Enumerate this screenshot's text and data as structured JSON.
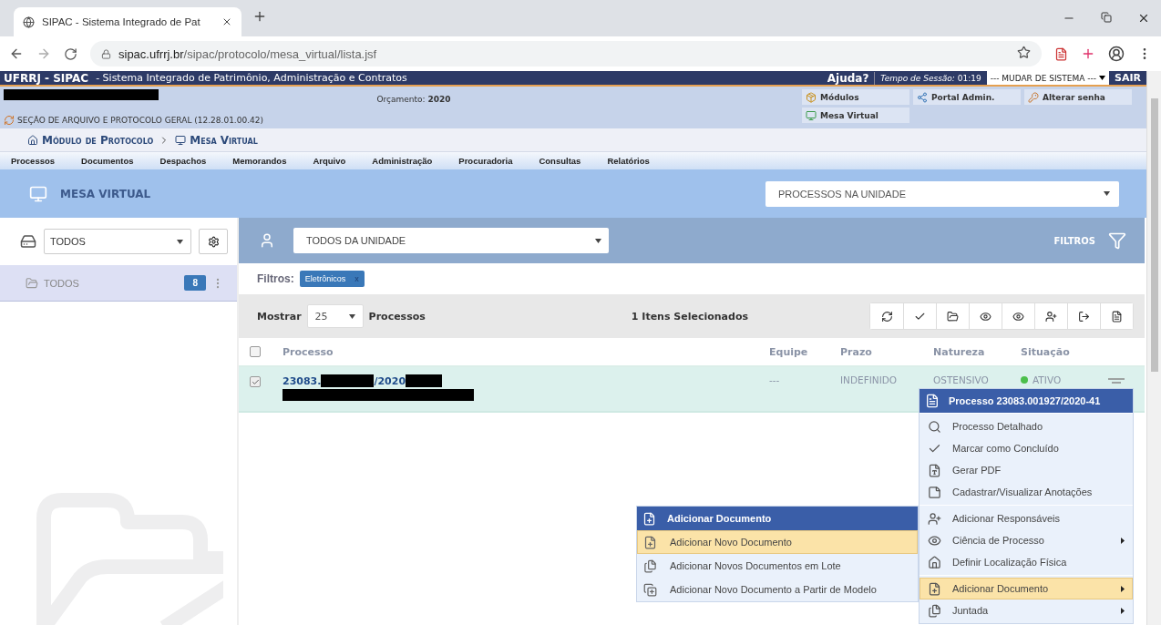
{
  "browser": {
    "tab_title": "SIPAC - Sistema Integrado de Pat",
    "url_host": "sipac.ufrrj.br",
    "url_path": "/sipac/protocolo/mesa_virtual/lista.jsf"
  },
  "top_bar": {
    "brand": "UFRRJ - SIPAC",
    "subtitle": "- Sistema Integrado de Patrimônio, Administração e Contratos",
    "help": "Ajuda?",
    "session_label": "Tempo de Sessão:",
    "session_time": "01:19",
    "system_select": "--- MUDAR DE SISTEMA ---",
    "logout": "SAIR"
  },
  "info": {
    "user_redacted": true,
    "unit": "SEÇÃO DE ARQUIVO E PROTOCOLO GERAL (12.28.01.00.42)",
    "budget_label": "Orçamento:",
    "budget_year": "2020",
    "links": [
      "Módulos",
      "Portal Admin.",
      "Alterar senha",
      "Mesa Virtual"
    ]
  },
  "breadcrumb": [
    "Módulo de Protocolo",
    "Mesa Virtual"
  ],
  "menu": [
    "Processos",
    "Documentos",
    "Despachos",
    "Memorandos",
    "Arquivo",
    "Administração",
    "Procuradoria",
    "Consultas",
    "Relatórios"
  ],
  "page_header": {
    "title": "MESA VIRTUAL",
    "view_select": "PROCESSOS NA UNIDADE"
  },
  "sidebar": {
    "select": "TODOS",
    "folders": [
      {
        "label": "TODOS",
        "count": "8",
        "selected": true
      }
    ]
  },
  "panel": {
    "owner_select": "TODOS DA UNIDADE",
    "filters_button": "FILTROS",
    "filters_label": "Filtros:",
    "filter_tags": [
      {
        "label": "Eletrônicos",
        "remove": "x"
      }
    ],
    "show_label": "Mostrar",
    "page_size": "25",
    "show_suffix": "Processos",
    "selection_count": "1 Itens Selecionados"
  },
  "table": {
    "columns": [
      "Processo",
      "Equipe",
      "Prazo",
      "Natureza",
      "Situação"
    ],
    "header_checked": false,
    "rows": [
      {
        "checked": true,
        "selected": true,
        "number_parts": [
          "23083.",
          "/2020"
        ],
        "redacted": true,
        "team": "---",
        "deadline": "INDEFINIDO",
        "nature": "OSTENSIVO",
        "status": "ATIVO",
        "color": "#4cbf4c"
      }
    ]
  },
  "context_menu": {
    "title": "Processo 23083.001927/2020-41",
    "groups": [
      [
        {
          "label": "Processo Detalhado",
          "has_submenu": false,
          "highlighted": false
        },
        {
          "label": "Marcar como Concluído",
          "has_submenu": false,
          "highlighted": false
        },
        {
          "label": "Gerar PDF",
          "has_submenu": false,
          "highlighted": false
        },
        {
          "label": "Cadastrar/Visualizar Anotações",
          "has_submenu": false,
          "highlighted": false
        }
      ],
      [
        {
          "label": "Adicionar Responsáveis",
          "has_submenu": false,
          "highlighted": false
        },
        {
          "label": "Ciência de Processo",
          "has_submenu": true,
          "highlighted": false
        },
        {
          "label": "Definir Localização Física",
          "has_submenu": false,
          "highlighted": false
        }
      ],
      [
        {
          "label": "Adicionar Documento",
          "has_submenu": true,
          "highlighted": true
        },
        {
          "label": "Juntada",
          "has_submenu": true,
          "highlighted": false
        }
      ]
    ]
  },
  "submenu": {
    "title": "Adicionar Documento",
    "items": [
      {
        "label": "Adicionar Novo Documento",
        "highlighted": true
      },
      {
        "label": "Adicionar Novos Documentos em Lote",
        "highlighted": false
      },
      {
        "label": "Adicionar Novo Documento a Partir de Modelo",
        "highlighted": false
      }
    ]
  }
}
